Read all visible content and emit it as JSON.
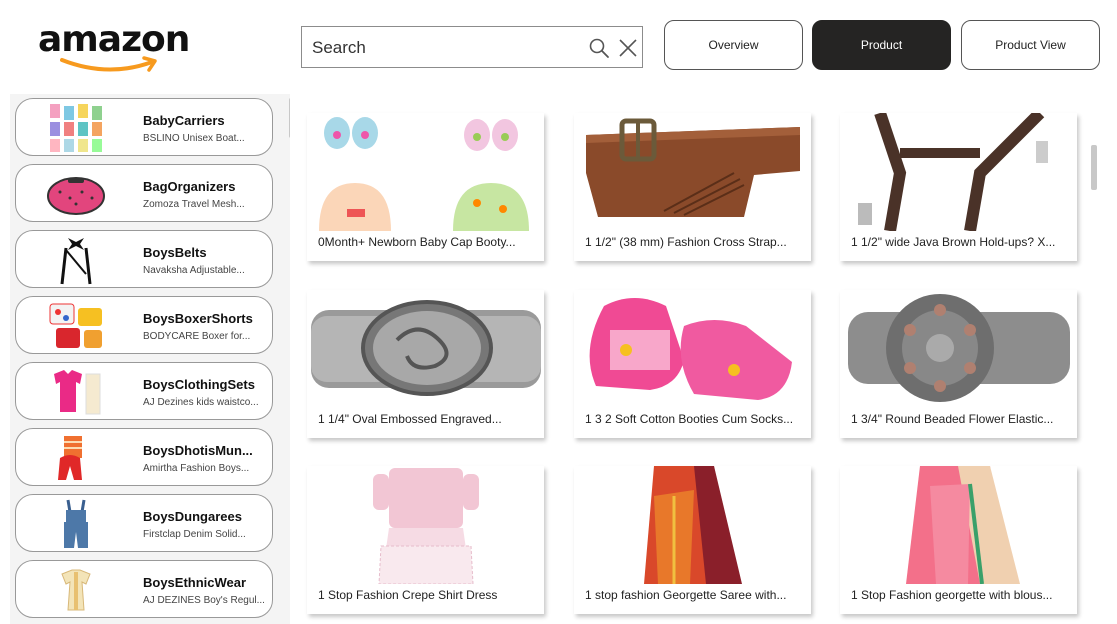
{
  "brand": {
    "name": "amazon",
    "accent": "#f79a1e"
  },
  "search": {
    "placeholder": "Search",
    "value": ""
  },
  "icons": {
    "search": "search-icon",
    "clear": "close-icon"
  },
  "nav": [
    {
      "label": "Overview",
      "active": false
    },
    {
      "label": "Product",
      "active": true
    },
    {
      "label": "Product View",
      "active": false
    }
  ],
  "categories": [
    {
      "name": "BabyCarriers",
      "sub": "BSLINO Unisex Boat..."
    },
    {
      "name": "BagOrganizers",
      "sub": "Zomoza Travel Mesh..."
    },
    {
      "name": "BoysBelts",
      "sub": "Navaksha Adjustable..."
    },
    {
      "name": "BoysBoxerShorts",
      "sub": "BODYCARE Boxer for..."
    },
    {
      "name": "BoysClothingSets",
      "sub": "AJ Dezines kids waistco..."
    },
    {
      "name": "BoysDhotisMun...",
      "sub": "Amirtha Fashion Boys..."
    },
    {
      "name": "BoysDungarees",
      "sub": "Firstclap Denim Solid..."
    },
    {
      "name": "BoysEthnicWear",
      "sub": "AJ DEZINES Boy's Regul..."
    }
  ],
  "products": [
    {
      "title": "0Month+ Newborn Baby Cap Booty..."
    },
    {
      "title": "1 1/2\" (38 mm) Fashion Cross Strap..."
    },
    {
      "title": "1 1/2\" wide Java Brown Hold-ups? X..."
    },
    {
      "title": "1 1/4\" Oval Embossed Engraved..."
    },
    {
      "title": "1 3 2 Soft Cotton Booties Cum Socks..."
    },
    {
      "title": "1 3/4\" Round Beaded Flower Elastic..."
    },
    {
      "title": "1 Stop Fashion Crepe Shirt Dress"
    },
    {
      "title": "1 stop fashion Georgette Saree with..."
    },
    {
      "title": "1 Stop Fashion georgette with blous..."
    }
  ]
}
